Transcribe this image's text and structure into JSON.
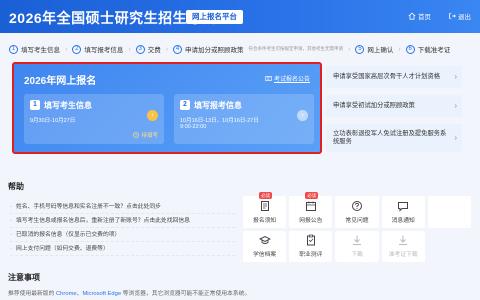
{
  "header": {
    "title": "2026年全国硕士研究生招生考试",
    "platform": "网上报名平台",
    "home_label": "首页",
    "logout_label": "退出"
  },
  "steps": [
    {
      "num": "1",
      "label": "填写考生信息",
      "note": ""
    },
    {
      "num": "2",
      "label": "填写报考信息",
      "note": ""
    },
    {
      "num": "3",
      "label": "交费",
      "note": ""
    },
    {
      "num": "4",
      "label": "申请加分或照顾政策",
      "note": "符合条件考生可按规定申请，其他考生无需申请"
    },
    {
      "num": "5",
      "label": "网上确认",
      "note": ""
    },
    {
      "num": "6",
      "label": "下载准考证",
      "note": ""
    }
  ],
  "registration": {
    "title": "2026年网上报名",
    "notice_label": "考试报名公告",
    "cards": [
      {
        "num": "1",
        "label": "填写考生信息",
        "date_line1": "9月30日-10月27日",
        "date_line2": "",
        "status": "待填写"
      },
      {
        "num": "2",
        "label": "填写报考信息",
        "date_line1": "10月16日-13日，10月16日-27日",
        "date_line2": "9:00-22:00",
        "status": ""
      }
    ]
  },
  "promos": [
    "申请享受国家高层次骨干人才计划资格",
    "申请享受初试加分或照顾政策",
    "立功表彰退役军人免试注册及提免服务系统服务"
  ],
  "help": {
    "title": "帮助",
    "items": [
      "姓名、手机号码等信息和实名注册不一致？点击此处同步",
      "填写考生信息或报名信息后，重新注册了新账号？点击此处找回信息",
      "已取消的报名信息（仅显示已交费的项）",
      "网上支付问题（如何交费、退费等）"
    ]
  },
  "tiles": [
    {
      "label": "报名须知",
      "icon": "document-icon",
      "badge": "必读",
      "disabled": false
    },
    {
      "label": "网报公告",
      "icon": "calendar-icon",
      "badge": "必读",
      "disabled": false
    },
    {
      "label": "常见问题",
      "icon": "question-icon",
      "badge": "",
      "disabled": false
    },
    {
      "label": "消息通知",
      "icon": "message-icon",
      "badge": "",
      "disabled": false
    },
    {
      "label": "",
      "icon": "",
      "badge": "",
      "disabled": true
    },
    {
      "label": "学信档案",
      "icon": "graduation-cap-icon",
      "badge": "",
      "disabled": false
    },
    {
      "label": "职业测评",
      "icon": "clipboard-icon",
      "badge": "",
      "disabled": false
    },
    {
      "label": "下载",
      "icon": "download-icon",
      "badge": "",
      "disabled": true
    },
    {
      "label": "准考证下载",
      "icon": "ticket-icon",
      "badge": "",
      "disabled": true
    }
  ],
  "notes": {
    "title": "注意事项",
    "text_prefix": "推荐使用最新版的 ",
    "chrome": "Chrome",
    "sep": "、",
    "edge": "Microsoft Edge",
    "text_suffix": " 等浏览器，其它浏览器可能不能正常使用本系统。"
  },
  "colors": {
    "brand": "#1a5fd6",
    "highlight_border": "#e02020",
    "badge": "#f04a4a"
  }
}
